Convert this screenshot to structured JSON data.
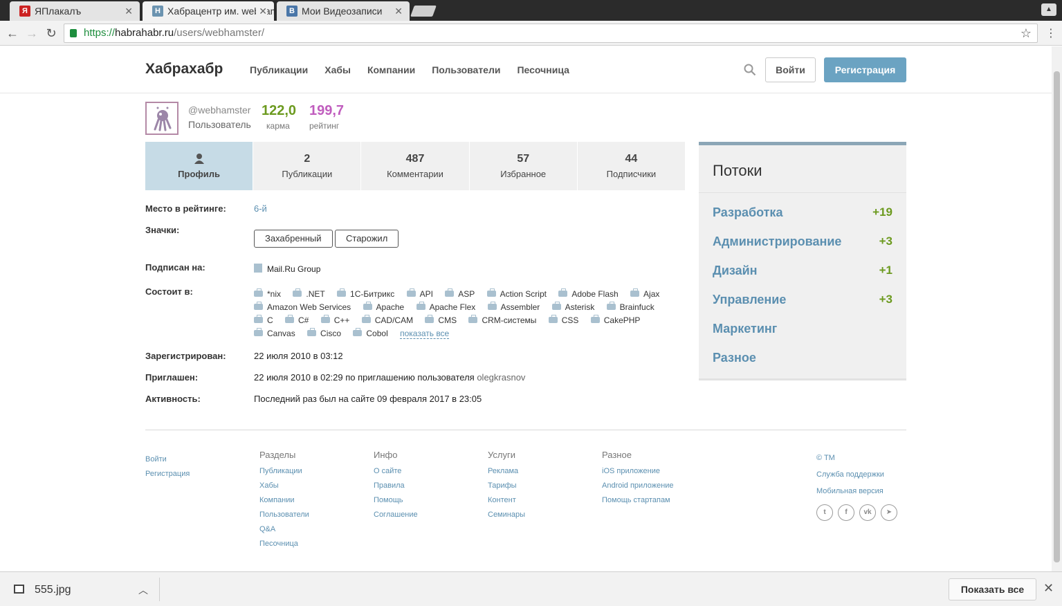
{
  "browser": {
    "tabs": [
      {
        "title": "ЯПлакалъ",
        "favicon": "Я",
        "color": "#cc2222"
      },
      {
        "title": "Хабрацентр им. webhamster",
        "favicon": "H",
        "color": "#6b93b0"
      },
      {
        "title": "Мои Видеозаписи",
        "favicon": "В",
        "color": "#4a76a8"
      }
    ],
    "url_scheme": "https://",
    "url_host": "habrahabr.ru",
    "url_path": "/users/webhamster/"
  },
  "header": {
    "logo": "Хабрахабр",
    "nav": [
      "Публикации",
      "Хабы",
      "Компании",
      "Пользователи",
      "Песочница"
    ],
    "login_label": "Войти",
    "register_label": "Регистрация"
  },
  "user": {
    "username": "@webhamster",
    "role": "Пользователь",
    "karma": "122,0",
    "karma_label": "карма",
    "rating": "199,7",
    "rating_label": "рейтинг"
  },
  "profile_tabs": [
    {
      "num": "",
      "label": "Профиль"
    },
    {
      "num": "2",
      "label": "Публикации"
    },
    {
      "num": "487",
      "label": "Комментарии"
    },
    {
      "num": "57",
      "label": "Избранное"
    },
    {
      "num": "44",
      "label": "Подписчики"
    }
  ],
  "details": {
    "rank_label": "Место в рейтинге:",
    "rank_value": "6-й",
    "badges_label": "Значки:",
    "badges": [
      "Захабренный",
      "Старожил"
    ],
    "subscribed_label": "Подписан на:",
    "subscribed_value": "Mail.Ru Group",
    "member_label": "Состоит в:",
    "hubs": [
      "*nix",
      ".NET",
      "1С-Битрикс",
      "API",
      "ASP",
      "Action Script",
      "Adobe Flash",
      "Ajax",
      "Amazon Web Services",
      "Apache",
      "Apache Flex",
      "Assembler",
      "Asterisk",
      "Brainfuck",
      "C",
      "C#",
      "C++",
      "CAD/CAM",
      "CMS",
      "CRM-системы",
      "CSS",
      "CakePHP",
      "Canvas",
      "Cisco",
      "Cobol"
    ],
    "show_all": "показать все",
    "registered_label": "Зарегистрирован:",
    "registered_value": "22 июля 2010 в 03:12",
    "invited_label": "Приглашен:",
    "invited_value": "22 июля 2010 в 02:29 по приглашению пользователя",
    "invited_by": "olegkrasnov",
    "activity_label": "Активность:",
    "activity_value": "Последний раз был на сайте 09 февраля 2017 в 23:05"
  },
  "streams": {
    "title": "Потоки",
    "items": [
      {
        "name": "Разработка",
        "count": "+19"
      },
      {
        "name": "Администрирование",
        "count": "+3"
      },
      {
        "name": "Дизайн",
        "count": "+1"
      },
      {
        "name": "Управление",
        "count": "+3"
      },
      {
        "name": "Маркетинг",
        "count": ""
      },
      {
        "name": "Разное",
        "count": ""
      }
    ]
  },
  "footer": {
    "auth": [
      "Войти",
      "Регистрация"
    ],
    "columns": [
      {
        "title": "Разделы",
        "links": [
          "Публикации",
          "Хабы",
          "Компании",
          "Пользователи",
          "Q&A",
          "Песочница"
        ]
      },
      {
        "title": "Инфо",
        "links": [
          "О сайте",
          "Правила",
          "Помощь",
          "Соглашение"
        ]
      },
      {
        "title": "Услуги",
        "links": [
          "Реклама",
          "Тарифы",
          "Контент",
          "Семинары"
        ]
      },
      {
        "title": "Разное",
        "links": [
          "iOS приложение",
          "Android приложение",
          "Помощь стартапам"
        ]
      }
    ],
    "right_links": [
      "© TM",
      "Служба поддержки",
      "Мобильная версия"
    ],
    "social_icons": [
      "twitter-icon",
      "facebook-icon",
      "vk-icon",
      "telegram-icon"
    ]
  },
  "download": {
    "filename": "555.jpg",
    "show_all": "Показать все"
  }
}
